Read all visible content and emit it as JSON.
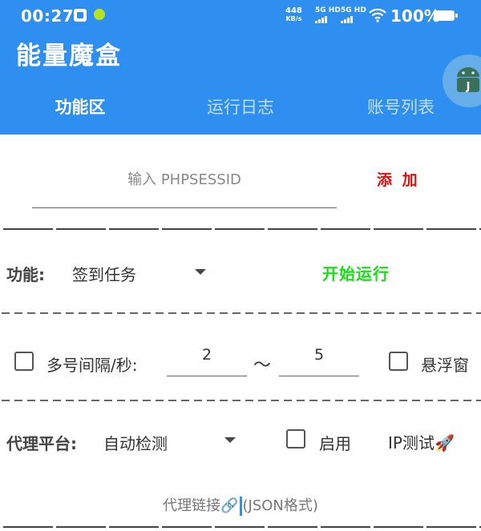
{
  "status_bar": {
    "time": "00:27",
    "speed_value": "448",
    "speed_unit": "KB/s",
    "net1": "5G HD",
    "net2": "5G HD",
    "battery": "100%"
  },
  "app": {
    "title": "能量魔盒"
  },
  "tabs": [
    {
      "label": "功能区",
      "active": true
    },
    {
      "label": "运行日志",
      "active": false
    },
    {
      "label": "账号列表",
      "active": false
    }
  ],
  "session": {
    "placeholder": "输入 PHPSESSID",
    "add_label": "添 加"
  },
  "function_row": {
    "label": "功能:",
    "selected": "签到任务",
    "start_label": "开始运行"
  },
  "interval_row": {
    "label": "多号间隔/秒:",
    "min": "2",
    "separator": "～",
    "max": "5",
    "float_label": "悬浮窗"
  },
  "proxy_row": {
    "label": "代理平台:",
    "selected": "自动检测",
    "enable_label": "启用",
    "ip_test_label": "IP测试🚀"
  },
  "proxy_link": {
    "placeholder_pre": "代理链接🔗",
    "placeholder_post": "(JSON格式)"
  },
  "colors": {
    "primary": "#2e8ff0",
    "add": "#e01010",
    "start": "#17e017"
  }
}
